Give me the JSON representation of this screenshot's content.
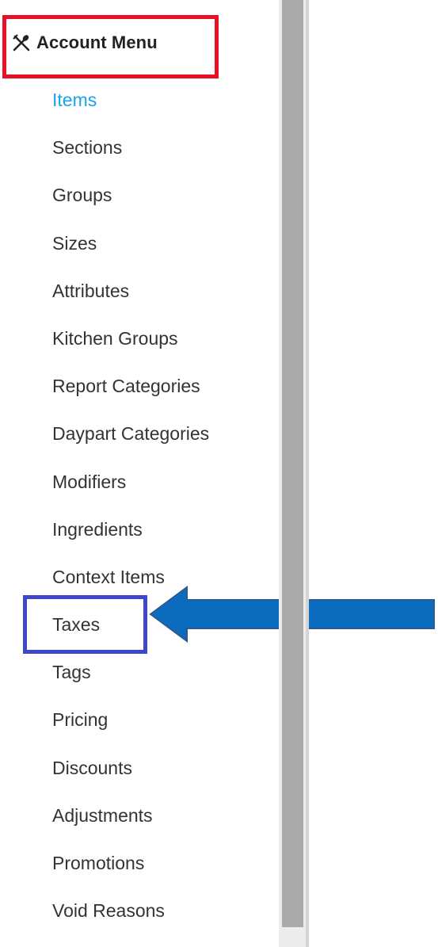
{
  "header": {
    "title": "Account Menu",
    "icon": "utensils-icon"
  },
  "nav": {
    "items": [
      {
        "label": "Items",
        "active": true
      },
      {
        "label": "Sections"
      },
      {
        "label": "Groups"
      },
      {
        "label": "Sizes"
      },
      {
        "label": "Attributes"
      },
      {
        "label": "Kitchen Groups"
      },
      {
        "label": "Report Categories"
      },
      {
        "label": "Daypart Categories"
      },
      {
        "label": "Modifiers"
      },
      {
        "label": "Ingredients"
      },
      {
        "label": "Context Items"
      },
      {
        "label": "Taxes"
      },
      {
        "label": "Tags"
      },
      {
        "label": "Pricing"
      },
      {
        "label": "Discounts"
      },
      {
        "label": "Adjustments"
      },
      {
        "label": "Promotions"
      },
      {
        "label": "Void Reasons"
      }
    ]
  },
  "annotations": {
    "header_box_color": "#e81123",
    "taxes_box_color": "#3e46cc",
    "arrow_color": "#0b6bbf",
    "arrow_target": "Taxes"
  },
  "colors": {
    "active_link": "#1aa3e8",
    "text": "#333333"
  }
}
